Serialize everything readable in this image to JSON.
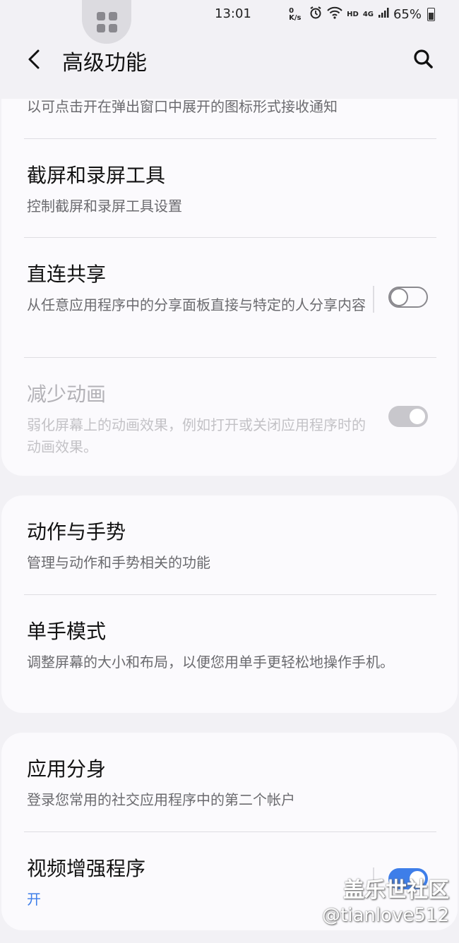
{
  "status_bar": {
    "time": "13:01",
    "net_speed": "0 K/s",
    "hd_label": "HD",
    "network_label": "4G",
    "battery": "65%"
  },
  "header": {
    "title": "高级功能"
  },
  "card1": {
    "partial_text": "以可点击开在弹出窗口中展开的图标形式接收通知",
    "items": [
      {
        "title": "截屏和录屏工具",
        "subtitle": "控制截屏和录屏工具设置"
      },
      {
        "title": "直连共享",
        "subtitle": "从任意应用程序中的分享面板直接与特定的人分享内容",
        "toggle": "off"
      },
      {
        "title": "减少动画",
        "subtitle": "弱化屏幕上的动画效果，例如打开或关闭应用程序时的动画效果。",
        "toggle": "on-disabled"
      }
    ]
  },
  "card2": {
    "items": [
      {
        "title": "动作与手势",
        "subtitle": "管理与动作和手势相关的功能"
      },
      {
        "title": "单手模式",
        "subtitle": "调整屏幕的大小和布局，以便您用单手更轻松地操作手机。"
      }
    ]
  },
  "card3": {
    "items": [
      {
        "title": "应用分身",
        "subtitle": "登录您常用的社交应用程序中的第二个帐户"
      },
      {
        "title": "视频增强程序",
        "status": "开",
        "toggle": "on"
      }
    ]
  },
  "watermark": {
    "line1": "盖乐世社区",
    "line2": "@tianlove512"
  },
  "colors": {
    "accent": "#3e7ee9",
    "background": "#f2f1f5",
    "card": "#fbfafd"
  }
}
